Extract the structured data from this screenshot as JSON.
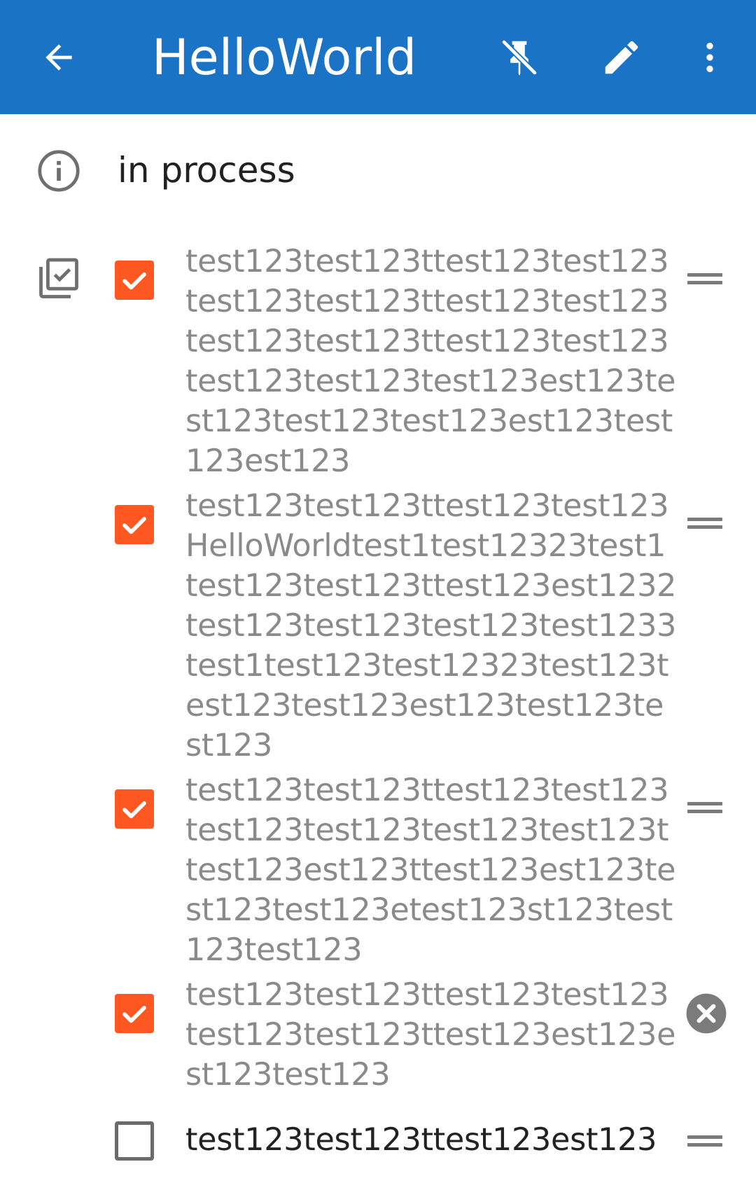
{
  "appbar": {
    "title": "HelloWorld",
    "back_icon": "arrow-left-icon",
    "pin_icon": "pin-off-icon",
    "edit_icon": "pencil-icon",
    "more_icon": "more-vertical-icon",
    "background_color": "#1a73c4"
  },
  "status": {
    "icon": "info-icon",
    "text": "in process"
  },
  "checklist": {
    "icon": "checklist-icon",
    "accent_color": "#ff5722",
    "items": [
      {
        "checked": true,
        "lines": [
          "test123test123ttest123test123",
          "test123test123ttest123test123",
          "test123test123ttest123test123",
          "test123test123test123est123te",
          "st123test123test123est123test",
          "123est123"
        ]
      },
      {
        "checked": true,
        "lines": [
          "test123test123ttest123test123",
          "HelloWorldtest1test12323test1",
          "test123test123ttest123est1232",
          "test123test123test123test1233",
          "test1test123test12323test123t",
          "est123test123est123test123te",
          "st123"
        ]
      },
      {
        "checked": true,
        "lines": [
          "test123test123ttest123test123",
          "test123test123test123test123t",
          "test123est123ttest123est123te",
          "st123test123etest123st123test",
          "123test123"
        ]
      },
      {
        "checked": true,
        "lines": [
          "test123test123ttest123test123",
          "test123test123ttest123est123e",
          "st123test123"
        ]
      },
      {
        "checked": false,
        "lines": [
          "test123test123ttest123est123"
        ]
      }
    ]
  }
}
